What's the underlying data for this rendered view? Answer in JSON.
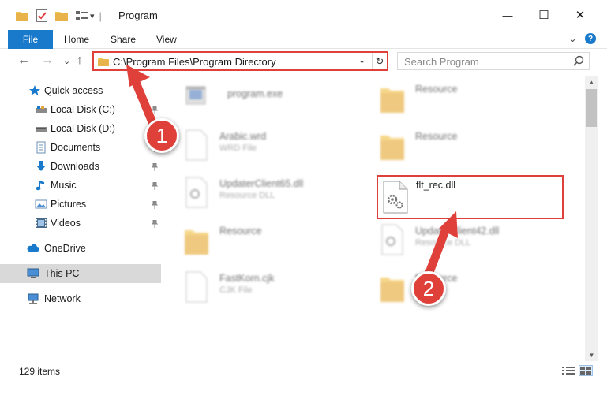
{
  "window": {
    "title": "Program",
    "minimize_glyph": "—",
    "maximize_glyph": "☐",
    "close_glyph": "✕"
  },
  "quick_access_toolbar": {
    "dropdown_glyph": "▾",
    "separator": "|"
  },
  "ribbon": {
    "tabs": [
      "File",
      "Home",
      "Share",
      "View"
    ],
    "expand_glyph": "⌄",
    "help_glyph": "?"
  },
  "nav": {
    "back_glyph": "←",
    "forward_glyph": "→",
    "recent_glyph": "⌄",
    "up_glyph": "↑"
  },
  "address": {
    "path": "C:\\Program Files\\Program Directory",
    "dropdown_glyph": "⌄",
    "refresh_glyph": "↻"
  },
  "search": {
    "placeholder": "Search Program"
  },
  "sidebar": {
    "items": [
      {
        "label": "Quick access",
        "icon": "star-icon",
        "pinned": false
      },
      {
        "label": "Local Disk (C:)",
        "icon": "drive-icon",
        "pinned": true
      },
      {
        "label": "Local Disk (D:)",
        "icon": "drive-icon",
        "pinned": false
      },
      {
        "label": "Documents",
        "icon": "documents-icon",
        "pinned": true
      },
      {
        "label": "Downloads",
        "icon": "download-icon",
        "pinned": true
      },
      {
        "label": "Music",
        "icon": "music-icon",
        "pinned": true
      },
      {
        "label": "Pictures",
        "icon": "pictures-icon",
        "pinned": true
      },
      {
        "label": "Videos",
        "icon": "videos-icon",
        "pinned": true
      },
      {
        "label": "OneDrive",
        "icon": "cloud-icon",
        "pinned": false
      },
      {
        "label": "This PC",
        "icon": "monitor-icon",
        "pinned": false,
        "selected": true
      },
      {
        "label": "Network",
        "icon": "network-icon",
        "pinned": false
      }
    ]
  },
  "files": [
    {
      "name": "program.exe",
      "type": "",
      "icon": "exe-icon"
    },
    {
      "name": "Resource",
      "type": "",
      "icon": "folder-icon"
    },
    {
      "name": "Arabic.wrd",
      "type": "WRD File",
      "icon": "file-icon"
    },
    {
      "name": "Resource",
      "type": "",
      "icon": "folder-icon"
    },
    {
      "name": "UpdaterClient65.dll",
      "type": "Resource DLL",
      "icon": "dll-icon"
    },
    {
      "name": "flt_rec.dll",
      "type": "",
      "icon": "dll-icon",
      "highlighted": true
    },
    {
      "name": "Resource",
      "type": "",
      "icon": "folder-icon"
    },
    {
      "name": "UpdaterClient42.dll",
      "type": "Resource DLL",
      "icon": "dll-icon"
    },
    {
      "name": "FastKorn.cjk",
      "type": "CJK File",
      "icon": "file-icon"
    },
    {
      "name": "Resource",
      "type": "",
      "icon": "folder-icon"
    }
  ],
  "status": {
    "item_count": "129 items"
  },
  "annotations": {
    "step1": "1",
    "step2": "2"
  },
  "colors": {
    "accent": "#1979ca",
    "annotation": "#e0403a",
    "folder": "#f3c75a"
  }
}
